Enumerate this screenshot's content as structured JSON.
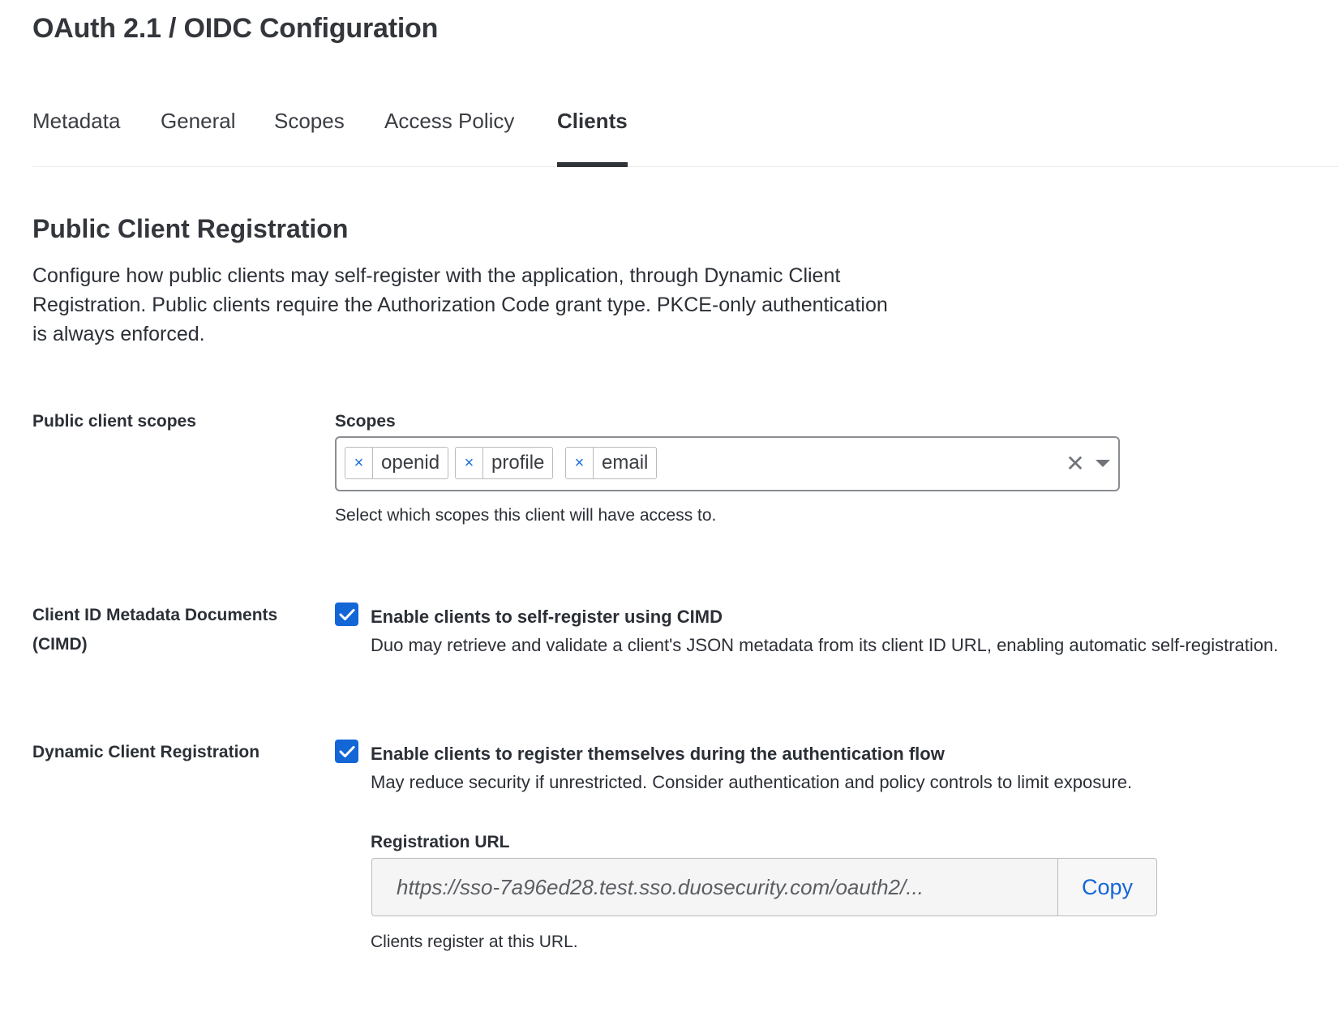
{
  "page": {
    "title": "OAuth 2.1 / OIDC Configuration"
  },
  "tabs": [
    {
      "label": "Metadata",
      "active": false
    },
    {
      "label": "General",
      "active": false
    },
    {
      "label": "Scopes",
      "active": false
    },
    {
      "label": "Access Policy",
      "active": false
    },
    {
      "label": "Clients",
      "active": true
    }
  ],
  "section": {
    "title": "Public Client Registration",
    "description": "Configure how public clients may self-register with the application, through Dynamic Client Registration. Public clients require the Authorization Code grant type. PKCE-only authentication is always enforced."
  },
  "scopes_row": {
    "label": "Public client scopes",
    "field_label": "Scopes",
    "selected": [
      {
        "label": "openid",
        "remove_icon": "close-icon"
      },
      {
        "label": "profile",
        "remove_icon": "close-icon"
      },
      {
        "label": "email",
        "remove_icon": "close-icon"
      }
    ],
    "help": "Select which scopes this client will have access to."
  },
  "cimd_row": {
    "label": "Client ID Metadata Documents (CIMD)",
    "checked": true,
    "checkbox_label": "Enable clients to self-register using CIMD",
    "description": "Duo may retrieve and validate a client's JSON metadata from its client ID URL, enabling automatic self-registration."
  },
  "dcr_row": {
    "label": "Dynamic Client Registration",
    "checked": true,
    "checkbox_label": "Enable clients to register themselves during the authentication flow",
    "description": "May reduce security if unrestricted. Consider authentication and policy controls to limit exposure.",
    "registration_url_label": "Registration URL",
    "registration_url_value": "https://sso-7a96ed28.test.sso.duosecurity.com/oauth2/...",
    "copy_label": "Copy",
    "help": "Clients register at this URL."
  },
  "colors": {
    "accent": "#1366d6",
    "text": "#2b2f36",
    "tab_indicator": "#2f3237"
  },
  "icons": {
    "checkbox": "checkmark-icon",
    "clear_all": "close-icon",
    "dropdown": "chevron-down-icon"
  }
}
